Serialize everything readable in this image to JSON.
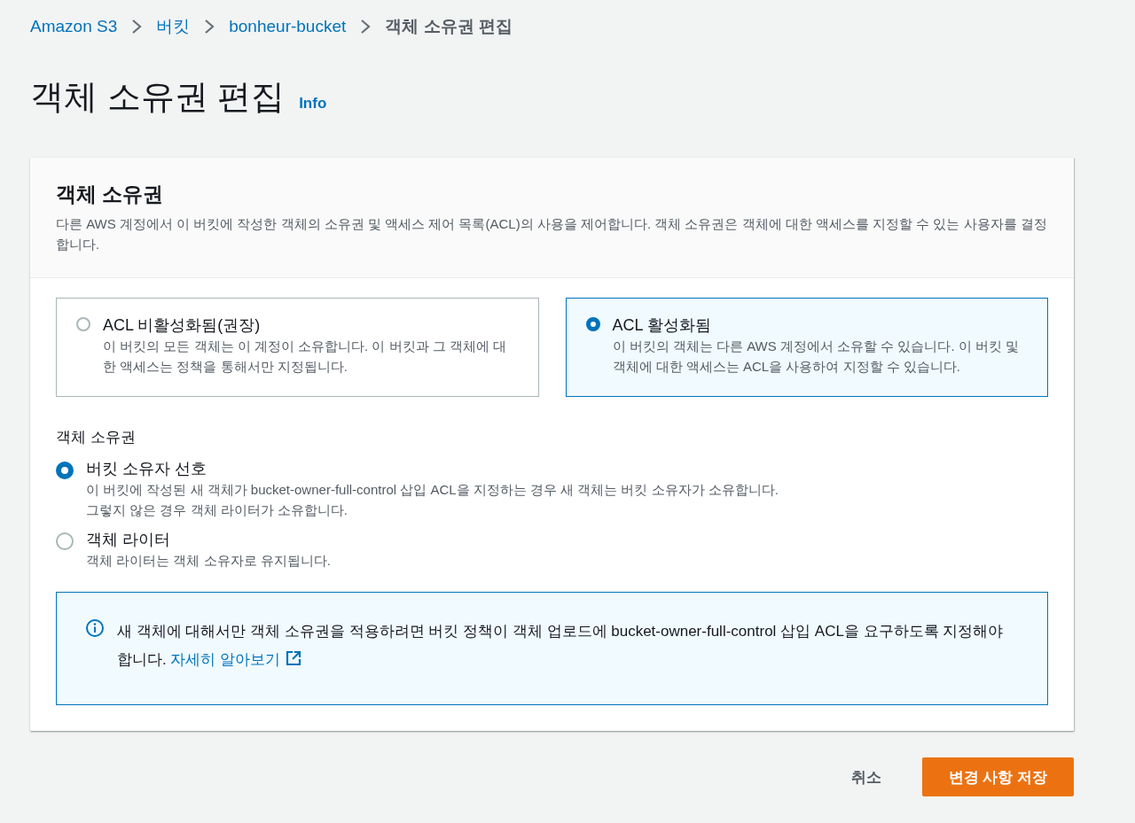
{
  "breadcrumb": [
    {
      "label": "Amazon S3",
      "kind": "link"
    },
    {
      "label": "버킷",
      "kind": "link"
    },
    {
      "label": "bonheur-bucket",
      "kind": "link"
    },
    {
      "label": "객체 소유권 편집",
      "kind": "current"
    }
  ],
  "page": {
    "title": "객체 소유권 편집",
    "info_link": "Info"
  },
  "panel": {
    "title": "객체 소유권",
    "description": "다른 AWS 계정에서 이 버킷에 작성한 객체의 소유권 및 액세스 제어 목록(ACL)의 사용을 제어합니다. 객체 소유권은 객체에 대한 액세스를 지정할 수 있는 사용자를 결정합니다.",
    "acl_options": [
      {
        "label": "ACL 비활성화됨(권장)",
        "description": "이 버킷의 모든 객체는 이 계정이 소유합니다. 이 버킷과 그 객체에 대한 액세스는 정책을 통해서만 지정됩니다.",
        "selected": false
      },
      {
        "label": "ACL 활성화됨",
        "description": "이 버킷의 객체는 다른 AWS 계정에서 소유할 수 있습니다. 이 버킷 및 객체에 대한 액세스는 ACL을 사용하여 지정할 수 있습니다.",
        "selected": true
      }
    ],
    "ownership": {
      "label": "객체 소유권",
      "options": [
        {
          "label": "버킷 소유자 선호",
          "description": "이 버킷에 작성된 새 객체가 bucket-owner-full-control 삽입 ACL을 지정하는 경우 새 객체는 버킷 소유자가 소유합니다. 그렇지 않은 경우 객체 라이터가 소유합니다.",
          "selected": true
        },
        {
          "label": "객체 라이터",
          "description": "객체 라이터는 객체 소유자로 유지됩니다.",
          "selected": false
        }
      ]
    },
    "alert": {
      "text": "새 객체에 대해서만 객체 소유권을 적용하려면 버킷 정책이 객체 업로드에 bucket-owner-full-control 삽입 ACL을 요구하도록 지정해야 합니다.",
      "link": "자세히 알아보기"
    }
  },
  "actions": {
    "cancel": "취소",
    "save": "변경 사항 저장"
  }
}
